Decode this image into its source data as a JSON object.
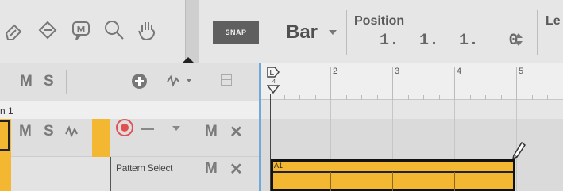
{
  "colors": {
    "track_color": "#f4b731",
    "selection_blue": "#6fa9d8",
    "record_red": "#e05050",
    "snap_bg": "#5f5f5f"
  },
  "toolbar": {
    "tools": [
      {
        "icon": "eraser-icon"
      },
      {
        "icon": "paint-bucket-icon"
      },
      {
        "icon": "marker-icon",
        "glyph": "M"
      },
      {
        "icon": "magnifier-icon"
      },
      {
        "icon": "hand-icon"
      }
    ],
    "snap_label": "SNAP",
    "grid_value": "Bar",
    "position_label": "Position",
    "position_value": "1.  1.  1.   0",
    "length_label": "Le"
  },
  "track_header": {
    "mute_label": "M",
    "solo_label": "S"
  },
  "section_label": "n 1",
  "track": {
    "mute_label": "M",
    "solo_label": "S",
    "dash": "—",
    "mute2_label": "M",
    "remove_label": "✕"
  },
  "pattern_lane": {
    "label": "Pattern Select",
    "mute_label": "M",
    "remove_label": "✕"
  },
  "ruler": {
    "loop_letter": "L",
    "loop_sub": "4",
    "bars": [
      "2",
      "3",
      "4",
      "5"
    ]
  },
  "pattern_clip": {
    "label": "A1"
  }
}
